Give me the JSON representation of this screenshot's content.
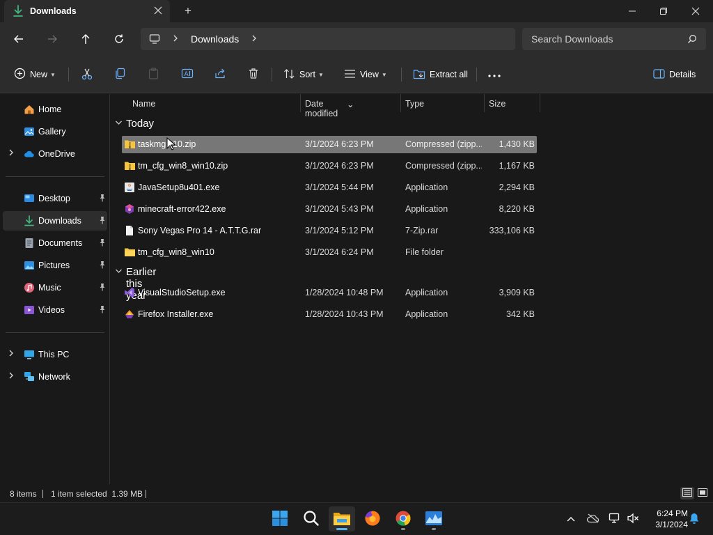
{
  "window": {
    "tab_title": "Downloads",
    "tab_icon": "download-icon",
    "new_tab_symbol": "+"
  },
  "address": {
    "breadcrumb": "Downloads",
    "search_placeholder": "Search Downloads"
  },
  "toolbar": {
    "new_label": "New",
    "sort_label": "Sort",
    "view_label": "View",
    "extract_label": "Extract all",
    "details_label": "Details"
  },
  "sidebar": {
    "quick": [
      {
        "label": "Home",
        "icon": "home-icon"
      },
      {
        "label": "Gallery",
        "icon": "gallery-icon"
      },
      {
        "label": "OneDrive",
        "icon": "cloud-icon"
      }
    ],
    "pinned": [
      {
        "label": "Desktop",
        "icon": "desktop-icon"
      },
      {
        "label": "Downloads",
        "icon": "download-icon",
        "selected": true
      },
      {
        "label": "Documents",
        "icon": "documents-icon"
      },
      {
        "label": "Pictures",
        "icon": "pictures-icon"
      },
      {
        "label": "Music",
        "icon": "music-icon"
      },
      {
        "label": "Videos",
        "icon": "videos-icon"
      }
    ],
    "devices": [
      {
        "label": "This PC",
        "icon": "pc-icon"
      },
      {
        "label": "Network",
        "icon": "network-icon"
      }
    ]
  },
  "columns": {
    "name": "Name",
    "date": "Date modified",
    "type": "Type",
    "size": "Size"
  },
  "groups": [
    {
      "title": "Today",
      "files": [
        {
          "name": "taskmgr_win10.zip",
          "shown_name": "taskmg   v10.zip",
          "date": "3/1/2024 6:23 PM",
          "type": "Compressed (zipp...",
          "size": "1,430 KB",
          "icon": "zip-folder-icon",
          "selected": true
        },
        {
          "name": "tm_cfg_win8_win10.zip",
          "date": "3/1/2024 6:23 PM",
          "type": "Compressed (zipp...",
          "size": "1,167 KB",
          "icon": "zip-folder-icon"
        },
        {
          "name": "JavaSetup8u401.exe",
          "date": "3/1/2024 5:44 PM",
          "type": "Application",
          "size": "2,294 KB",
          "icon": "java-icon"
        },
        {
          "name": "minecraft-error422.exe",
          "date": "3/1/2024 5:43 PM",
          "type": "Application",
          "size": "8,220 KB",
          "icon": "app-icon"
        },
        {
          "name": "Sony Vegas Pro 14 - A.T.T.G.rar",
          "date": "3/1/2024 5:12 PM",
          "type": "7-Zip.rar",
          "size": "333,106 KB",
          "icon": "file-icon"
        },
        {
          "name": "tm_cfg_win8_win10",
          "date": "3/1/2024 6:24 PM",
          "type": "File folder",
          "size": "",
          "icon": "folder-icon"
        }
      ]
    },
    {
      "title": "Earlier this year",
      "files": [
        {
          "name": "VisualStudioSetup.exe",
          "date": "1/28/2024 10:48 PM",
          "type": "Application",
          "size": "3,909 KB",
          "icon": "visual-studio-icon"
        },
        {
          "name": "Firefox Installer.exe",
          "date": "1/28/2024 10:43 PM",
          "type": "Application",
          "size": "342 KB",
          "icon": "firefox-installer-icon"
        }
      ]
    }
  ],
  "status": {
    "item_count": "8 items",
    "selection": "1 item selected  1.39 MB"
  },
  "taskbar": {
    "time": "6:24 PM",
    "date": "3/1/2024"
  },
  "colors": {
    "accent": "#4cc2ff",
    "folder": "#f5c542",
    "selected_row": "#777777"
  }
}
